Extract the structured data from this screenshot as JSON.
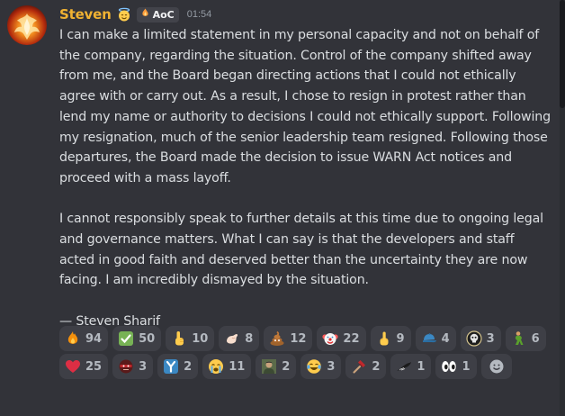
{
  "message": {
    "author": "Steven",
    "author_color": "#f0b232",
    "author_emoji": "smiling-face-with-halo-icon",
    "guild_tag": {
      "icon": "fire-hand-icon",
      "label": "AoC"
    },
    "timestamp": "01:54",
    "paragraphs": [
      "I can make a limited statement in my personal capacity and not on behalf of the company, regarding the situation. Control of the company shifted away from me, and the Board began directing actions that I could not ethically agree with or carry out. As a result, I chose to resign in protest rather than lend my name or authority to decisions I could not ethically support. Following my resignation, much of the senior leadership team resigned. Following those departures, the Board made the decision to issue WARN Act notices and proceed with a mass layoff.",
      "I cannot responsibly speak to further details at this time due to ongoing legal and governance matters. What I can say is that the developers and staff acted in good faith and deserved better than the uncertainty they are now facing. I am incredibly dismayed by the situation.",
      "— Steven Sharif"
    ]
  },
  "reactions": [
    {
      "icon": "fire-icon",
      "count": "94"
    },
    {
      "icon": "check-mark-button-icon",
      "count": "50"
    },
    {
      "icon": "backhand-index-pointing-up-icon",
      "count": "10"
    },
    {
      "icon": "pinching-hand-icon",
      "count": "8"
    },
    {
      "icon": "pile-of-poo-icon",
      "count": "12"
    },
    {
      "icon": "clown-face-icon",
      "count": "22"
    },
    {
      "icon": "middle-finger-icon",
      "count": "9"
    },
    {
      "icon": "blue-cap-icon",
      "count": "4"
    },
    {
      "icon": "custom-skull-emblem-icon",
      "count": "3"
    },
    {
      "icon": "custom-green-figure-icon",
      "count": "6"
    },
    {
      "icon": "red-heart-icon",
      "count": "25"
    },
    {
      "icon": "custom-red-masked-face-icon",
      "count": "3"
    },
    {
      "icon": "custom-blue-y-icon",
      "count": "2"
    },
    {
      "icon": "loudly-crying-face-icon",
      "count": "11"
    },
    {
      "icon": "custom-portrait-icon",
      "count": "2"
    },
    {
      "icon": "face-with-tears-of-joy-icon",
      "count": "3"
    },
    {
      "icon": "custom-hammer-icon",
      "count": "2"
    },
    {
      "icon": "custom-black-bird-icon",
      "count": "1"
    },
    {
      "icon": "eyes-icon",
      "count": "1"
    }
  ],
  "add_reaction": {
    "icon": "add-reaction-smiley-icon"
  },
  "colors": {
    "background": "#323339",
    "text": "#dbdee1",
    "muted": "#949ba4",
    "reaction_bg": "#3e3f46",
    "reaction_count": "#b5bac1"
  }
}
